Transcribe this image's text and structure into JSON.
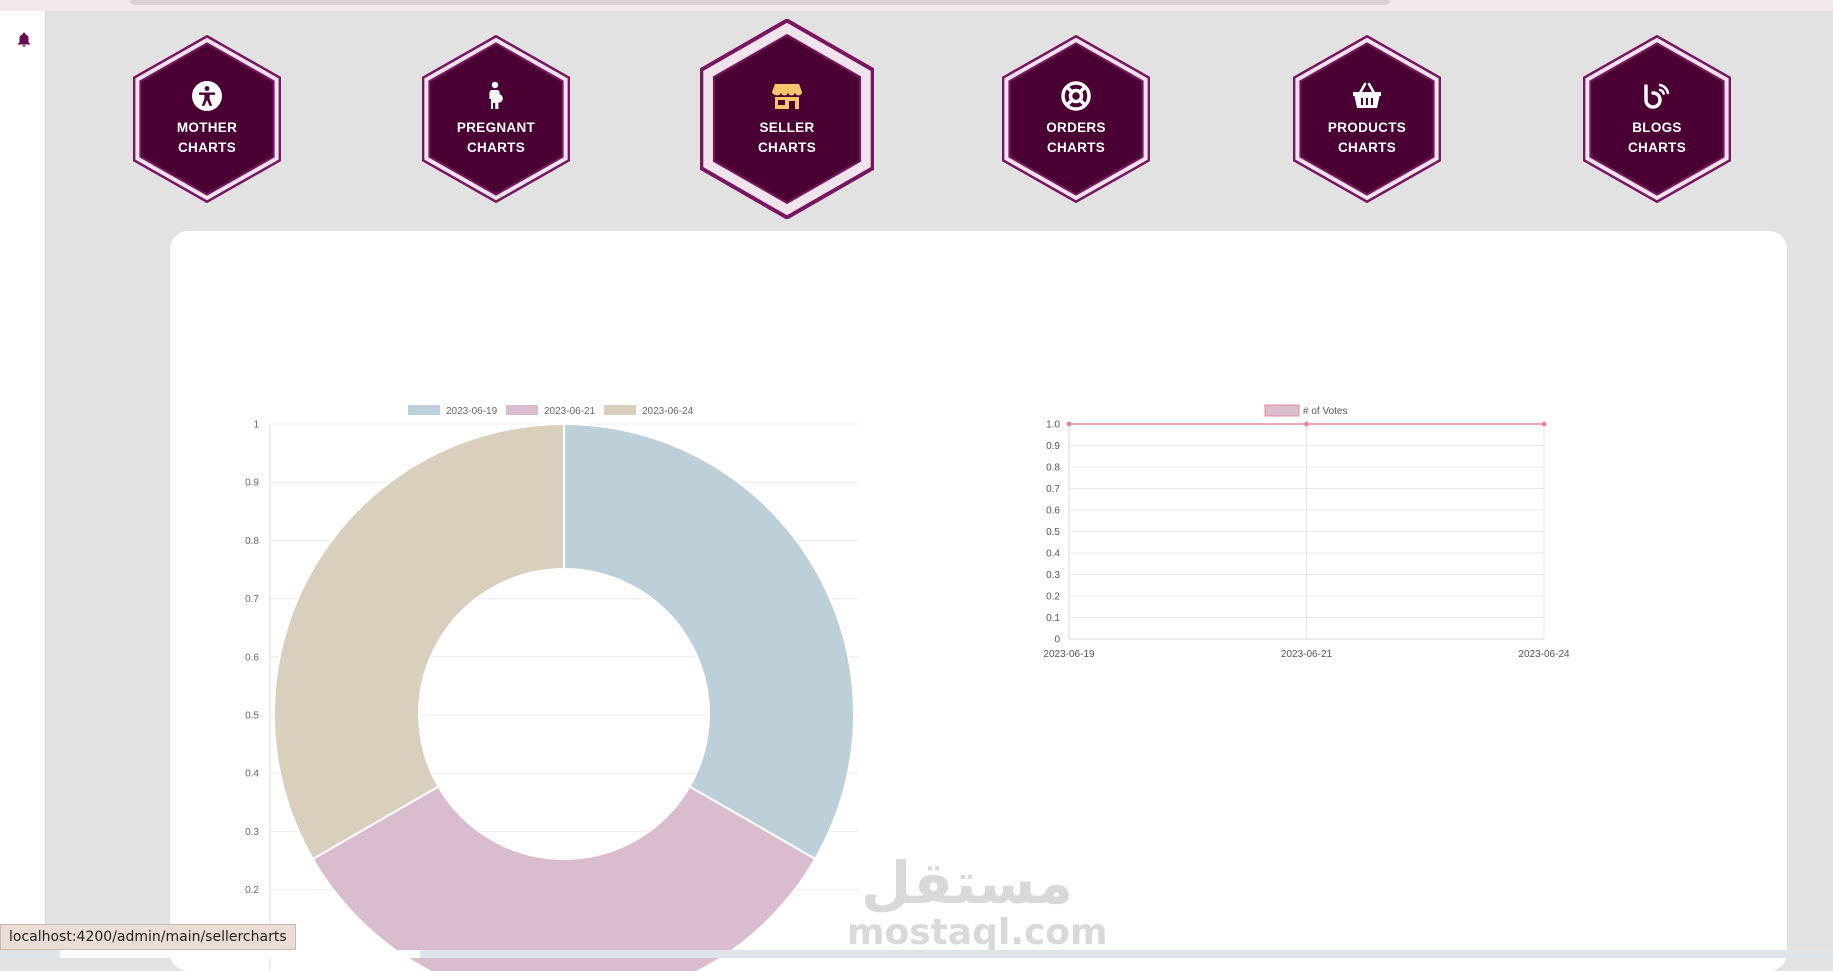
{
  "topbar": {},
  "sidebar": {
    "icons": [
      "bell-icon"
    ]
  },
  "nav": {
    "items": [
      {
        "icon": "accessibility-icon",
        "line1": "MOTHER",
        "line2": "CHARTS",
        "active": false
      },
      {
        "icon": "pregnant-person-icon",
        "line1": "PREGNANT",
        "line2": "CHARTS",
        "active": false
      },
      {
        "icon": "store-icon",
        "line1": "SELLER",
        "line2": "CHARTS",
        "active": true
      },
      {
        "icon": "lifebuoy-icon",
        "line1": "ORDERS",
        "line2": "CHARTS",
        "active": false
      },
      {
        "icon": "basket-icon",
        "line1": "PRODUCTS",
        "line2": "CHARTS",
        "active": false
      },
      {
        "icon": "blog-icon",
        "line1": "BLOGS",
        "line2": "CHARTS",
        "active": false
      }
    ]
  },
  "colors": {
    "hex_fill": "#4a0033",
    "hex_border": "#7a1561",
    "accent_icon": "#f4c86a",
    "background": "#e2e2e2"
  },
  "chart_data": [
    {
      "type": "pie",
      "variant": "doughnut",
      "legend_position": "top",
      "categories": [
        "2023-06-19",
        "2023-06-21",
        "2023-06-24"
      ],
      "values": [
        1,
        1,
        1
      ],
      "colors": [
        "#bdd0da",
        "#d9bccd",
        "#d9cfbd"
      ],
      "y_ticks": [
        "0.2",
        "0.3",
        "0.4",
        "0.5",
        "0.6",
        "0.7",
        "0.8",
        "0.9",
        "1"
      ],
      "grid": true
    },
    {
      "type": "line",
      "legend_position": "top",
      "series": [
        {
          "name": "# of Votes",
          "values": [
            1,
            1,
            1
          ],
          "color": "#e8899f",
          "legend_fill": "#d9bccd"
        }
      ],
      "categories": [
        "2023-06-19",
        "2023-06-21",
        "2023-06-24"
      ],
      "y_ticks": [
        "0",
        "0.1",
        "0.2",
        "0.3",
        "0.4",
        "0.5",
        "0.6",
        "0.7",
        "0.8",
        "0.9",
        "1.0"
      ],
      "ylim": [
        0,
        1
      ],
      "grid": true
    }
  ],
  "statusbar": {
    "url": "localhost:4200/admin/main/sellercharts"
  },
  "watermark": {
    "ar": "مستقل",
    "en": "mostaql.com"
  }
}
